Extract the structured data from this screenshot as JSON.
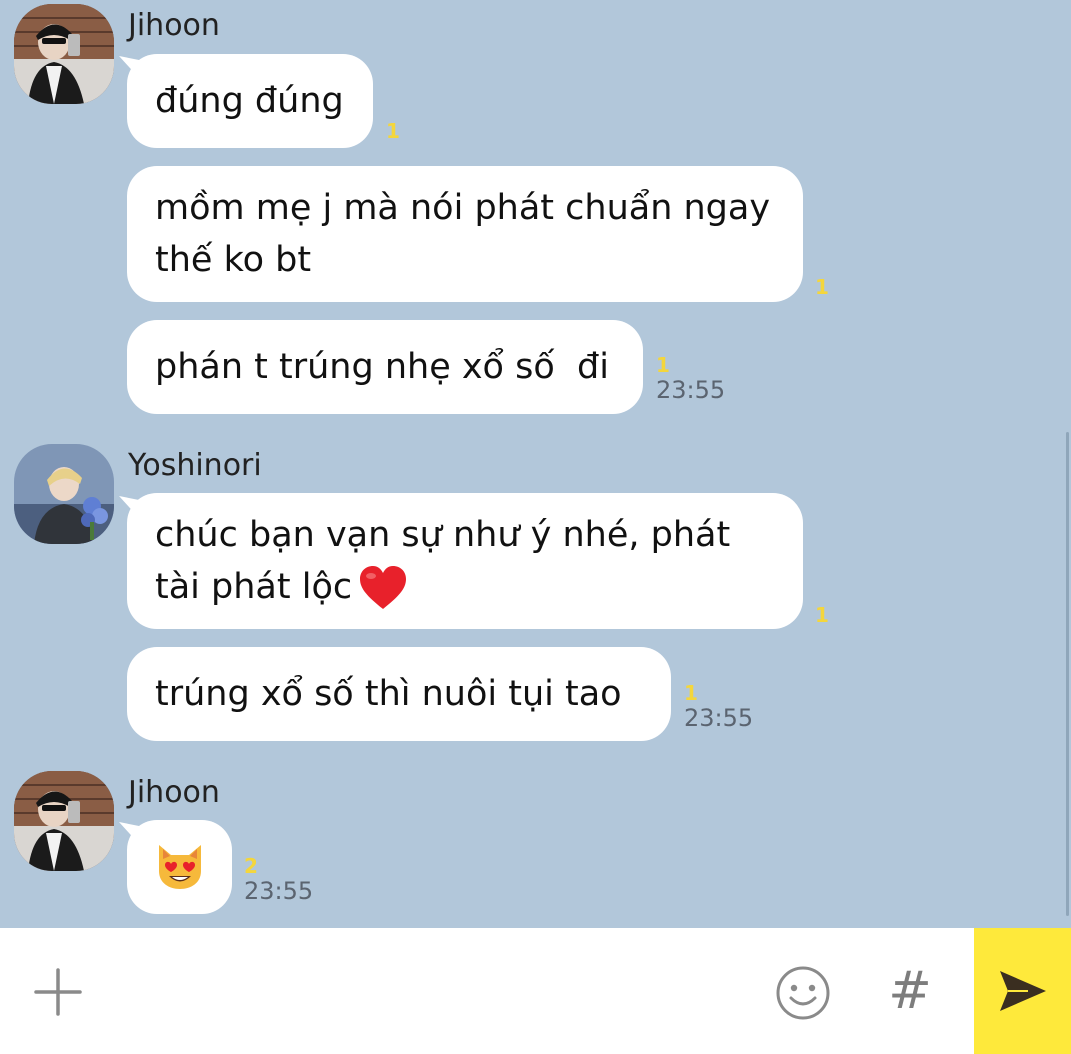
{
  "colors": {
    "chat_background": "#b2c7da",
    "bubble": "#ffffff",
    "unread_count": "#f4d63c",
    "send_button": "#fee93b"
  },
  "messages": [
    {
      "sender": "Jihoon",
      "bubbles": [
        {
          "text": "đúng đúng",
          "unread": "1"
        },
        {
          "text": "mồm mẹ j mà nói phát chuẩn ngay\nthế ko bt",
          "unread": "1"
        },
        {
          "text": "phán t trúng nhẹ xổ số  đi",
          "unread": "1",
          "time": "23:55"
        }
      ]
    },
    {
      "sender": "Yoshinori",
      "bubbles": [
        {
          "text": "chúc bạn vạn sự như ý nhé, phát\ntài phát lộc",
          "emoji": "red-heart-icon",
          "unread": "1"
        },
        {
          "text": "trúng xổ số thì nuôi tụi tao",
          "unread": "1",
          "time": "23:55"
        }
      ]
    },
    {
      "sender": "Jihoon",
      "bubbles": [
        {
          "emoji": "heart-eyes-cat-icon",
          "unread": "2",
          "time": "23:55"
        }
      ]
    }
  ],
  "input_bar": {
    "placeholder": "",
    "icons": {
      "plus": "plus-icon",
      "emoji": "emoticon-icon",
      "hash": "#",
      "send": "send-icon"
    }
  }
}
